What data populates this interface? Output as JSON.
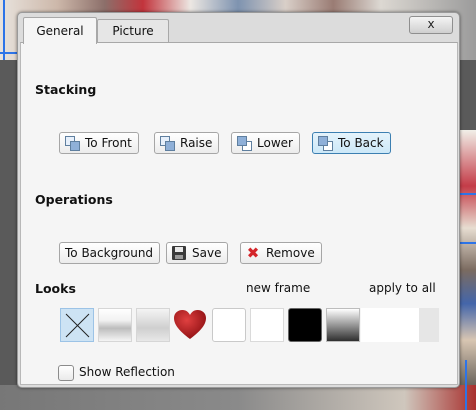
{
  "tabs": [
    {
      "label": "General",
      "active": true
    },
    {
      "label": "Picture",
      "active": false
    }
  ],
  "close_label": "x",
  "stacking": {
    "title": "Stacking",
    "buttons": {
      "to_front": "To Front",
      "raise": "Raise",
      "lower": "Lower",
      "to_back": "To Back"
    },
    "pressed": "to_back"
  },
  "operations": {
    "title": "Operations",
    "buttons": {
      "to_background": "To Background",
      "save": "Save",
      "remove": "Remove"
    }
  },
  "looks": {
    "title": "Looks",
    "new_frame": "new frame",
    "apply_to_all": "apply to all",
    "swatches": [
      "none",
      "gradient-light",
      "gradient-gray",
      "heart",
      "white-rounded",
      "white",
      "black",
      "gradient-dark",
      "blank"
    ],
    "selected": "none"
  },
  "show_reflection": {
    "label": "Show Reflection",
    "checked": false
  },
  "colors": {
    "selection": "#cde3f4",
    "pressed_border": "#3c7fb1",
    "heart": "#b0161a",
    "remove_icon": "#d4252a",
    "guide_lines": "#2d74e8"
  }
}
